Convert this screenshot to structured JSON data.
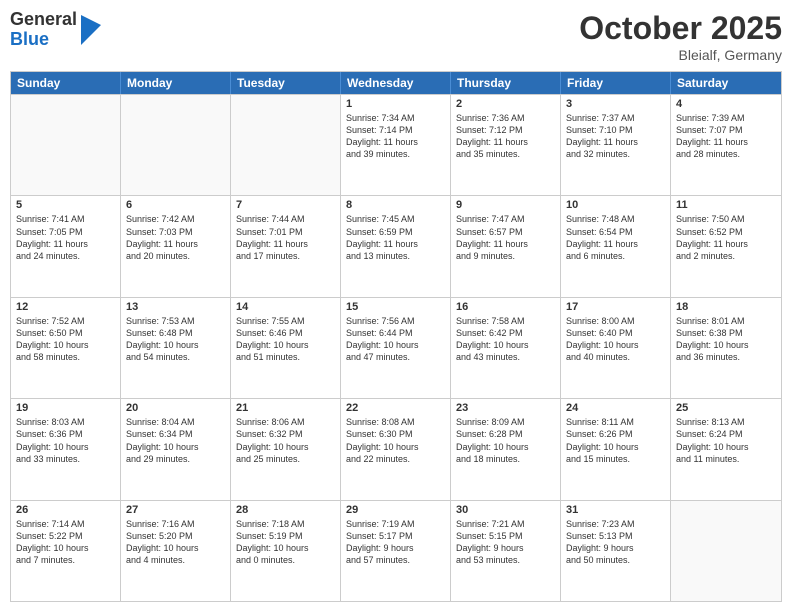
{
  "header": {
    "logo_general": "General",
    "logo_blue": "Blue",
    "month": "October 2025",
    "location": "Bleialf, Germany"
  },
  "weekdays": [
    "Sunday",
    "Monday",
    "Tuesday",
    "Wednesday",
    "Thursday",
    "Friday",
    "Saturday"
  ],
  "rows": [
    [
      {
        "day": "",
        "info": ""
      },
      {
        "day": "",
        "info": ""
      },
      {
        "day": "",
        "info": ""
      },
      {
        "day": "1",
        "info": "Sunrise: 7:34 AM\nSunset: 7:14 PM\nDaylight: 11 hours\nand 39 minutes."
      },
      {
        "day": "2",
        "info": "Sunrise: 7:36 AM\nSunset: 7:12 PM\nDaylight: 11 hours\nand 35 minutes."
      },
      {
        "day": "3",
        "info": "Sunrise: 7:37 AM\nSunset: 7:10 PM\nDaylight: 11 hours\nand 32 minutes."
      },
      {
        "day": "4",
        "info": "Sunrise: 7:39 AM\nSunset: 7:07 PM\nDaylight: 11 hours\nand 28 minutes."
      }
    ],
    [
      {
        "day": "5",
        "info": "Sunrise: 7:41 AM\nSunset: 7:05 PM\nDaylight: 11 hours\nand 24 minutes."
      },
      {
        "day": "6",
        "info": "Sunrise: 7:42 AM\nSunset: 7:03 PM\nDaylight: 11 hours\nand 20 minutes."
      },
      {
        "day": "7",
        "info": "Sunrise: 7:44 AM\nSunset: 7:01 PM\nDaylight: 11 hours\nand 17 minutes."
      },
      {
        "day": "8",
        "info": "Sunrise: 7:45 AM\nSunset: 6:59 PM\nDaylight: 11 hours\nand 13 minutes."
      },
      {
        "day": "9",
        "info": "Sunrise: 7:47 AM\nSunset: 6:57 PM\nDaylight: 11 hours\nand 9 minutes."
      },
      {
        "day": "10",
        "info": "Sunrise: 7:48 AM\nSunset: 6:54 PM\nDaylight: 11 hours\nand 6 minutes."
      },
      {
        "day": "11",
        "info": "Sunrise: 7:50 AM\nSunset: 6:52 PM\nDaylight: 11 hours\nand 2 minutes."
      }
    ],
    [
      {
        "day": "12",
        "info": "Sunrise: 7:52 AM\nSunset: 6:50 PM\nDaylight: 10 hours\nand 58 minutes."
      },
      {
        "day": "13",
        "info": "Sunrise: 7:53 AM\nSunset: 6:48 PM\nDaylight: 10 hours\nand 54 minutes."
      },
      {
        "day": "14",
        "info": "Sunrise: 7:55 AM\nSunset: 6:46 PM\nDaylight: 10 hours\nand 51 minutes."
      },
      {
        "day": "15",
        "info": "Sunrise: 7:56 AM\nSunset: 6:44 PM\nDaylight: 10 hours\nand 47 minutes."
      },
      {
        "day": "16",
        "info": "Sunrise: 7:58 AM\nSunset: 6:42 PM\nDaylight: 10 hours\nand 43 minutes."
      },
      {
        "day": "17",
        "info": "Sunrise: 8:00 AM\nSunset: 6:40 PM\nDaylight: 10 hours\nand 40 minutes."
      },
      {
        "day": "18",
        "info": "Sunrise: 8:01 AM\nSunset: 6:38 PM\nDaylight: 10 hours\nand 36 minutes."
      }
    ],
    [
      {
        "day": "19",
        "info": "Sunrise: 8:03 AM\nSunset: 6:36 PM\nDaylight: 10 hours\nand 33 minutes."
      },
      {
        "day": "20",
        "info": "Sunrise: 8:04 AM\nSunset: 6:34 PM\nDaylight: 10 hours\nand 29 minutes."
      },
      {
        "day": "21",
        "info": "Sunrise: 8:06 AM\nSunset: 6:32 PM\nDaylight: 10 hours\nand 25 minutes."
      },
      {
        "day": "22",
        "info": "Sunrise: 8:08 AM\nSunset: 6:30 PM\nDaylight: 10 hours\nand 22 minutes."
      },
      {
        "day": "23",
        "info": "Sunrise: 8:09 AM\nSunset: 6:28 PM\nDaylight: 10 hours\nand 18 minutes."
      },
      {
        "day": "24",
        "info": "Sunrise: 8:11 AM\nSunset: 6:26 PM\nDaylight: 10 hours\nand 15 minutes."
      },
      {
        "day": "25",
        "info": "Sunrise: 8:13 AM\nSunset: 6:24 PM\nDaylight: 10 hours\nand 11 minutes."
      }
    ],
    [
      {
        "day": "26",
        "info": "Sunrise: 7:14 AM\nSunset: 5:22 PM\nDaylight: 10 hours\nand 7 minutes."
      },
      {
        "day": "27",
        "info": "Sunrise: 7:16 AM\nSunset: 5:20 PM\nDaylight: 10 hours\nand 4 minutes."
      },
      {
        "day": "28",
        "info": "Sunrise: 7:18 AM\nSunset: 5:19 PM\nDaylight: 10 hours\nand 0 minutes."
      },
      {
        "day": "29",
        "info": "Sunrise: 7:19 AM\nSunset: 5:17 PM\nDaylight: 9 hours\nand 57 minutes."
      },
      {
        "day": "30",
        "info": "Sunrise: 7:21 AM\nSunset: 5:15 PM\nDaylight: 9 hours\nand 53 minutes."
      },
      {
        "day": "31",
        "info": "Sunrise: 7:23 AM\nSunset: 5:13 PM\nDaylight: 9 hours\nand 50 minutes."
      },
      {
        "day": "",
        "info": ""
      }
    ]
  ]
}
